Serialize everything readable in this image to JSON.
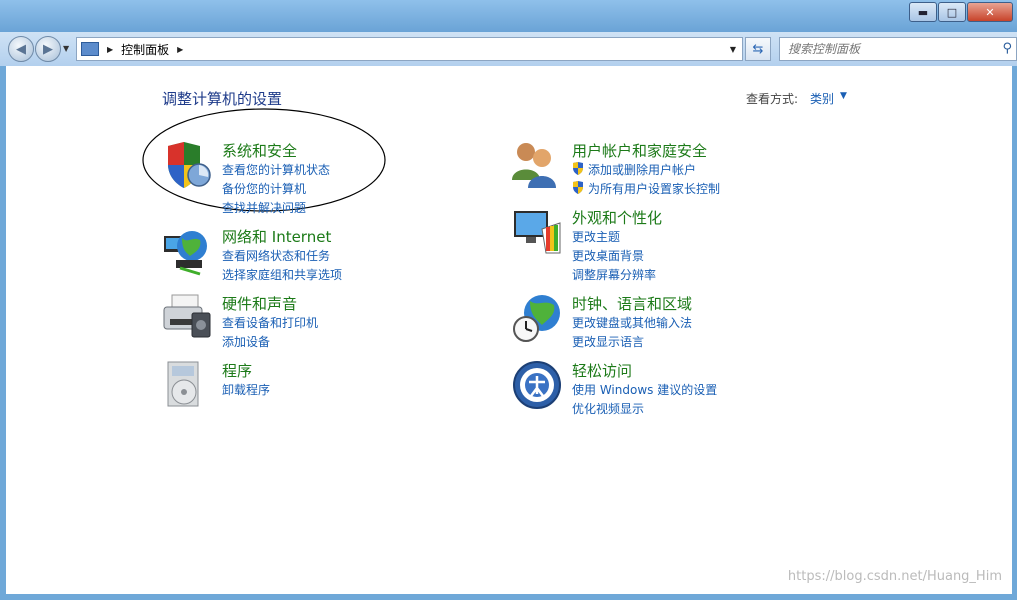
{
  "window": {
    "minimize": "▬",
    "maximize": "□",
    "close": "✕"
  },
  "address": {
    "crumb": "控制面板"
  },
  "search": {
    "placeholder": "搜索控制面板"
  },
  "header": {
    "title": "调整计算机的设置",
    "view_label": "查看方式:",
    "view_value": "类别"
  },
  "categories": [
    {
      "title": "系统和安全",
      "links": [
        "查看您的计算机状态",
        "备份您的计算机",
        "查找并解决问题"
      ]
    },
    {
      "title": "网络和 Internet",
      "links": [
        "查看网络状态和任务",
        "选择家庭组和共享选项"
      ]
    },
    {
      "title": "硬件和声音",
      "links": [
        "查看设备和打印机",
        "添加设备"
      ]
    },
    {
      "title": "程序",
      "links": [
        "卸载程序"
      ]
    },
    {
      "title": "用户帐户和家庭安全",
      "links": [
        "添加或删除用户帐户",
        "为所有用户设置家长控制"
      ]
    },
    {
      "title": "外观和个性化",
      "links": [
        "更改主题",
        "更改桌面背景",
        "调整屏幕分辨率"
      ]
    },
    {
      "title": "时钟、语言和区域",
      "links": [
        "更改键盘或其他输入法",
        "更改显示语言"
      ]
    },
    {
      "title": "轻松访问",
      "links": [
        "使用 Windows 建议的设置",
        "优化视频显示"
      ]
    }
  ],
  "watermark": "https://blog.csdn.net/Huang_Him"
}
